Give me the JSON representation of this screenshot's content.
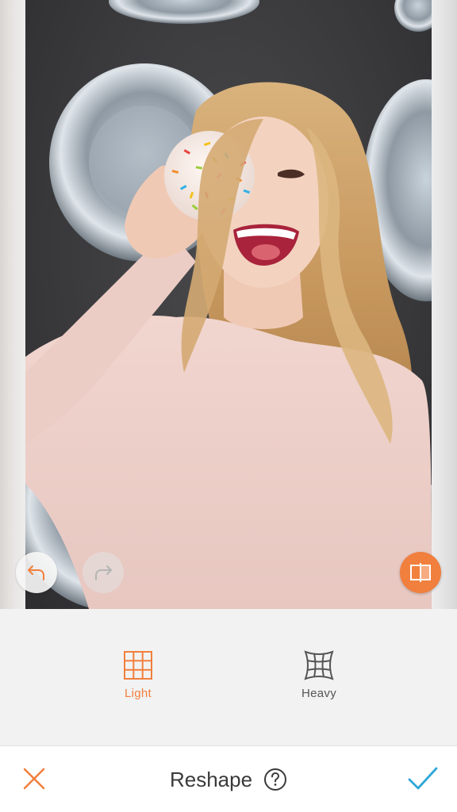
{
  "editor": {
    "tool_title": "Reshape",
    "modes": [
      {
        "label": "Light",
        "icon": "grid-light-icon",
        "selected": true
      },
      {
        "label": "Heavy",
        "icon": "grid-warp-icon",
        "selected": false
      }
    ]
  },
  "controls": {
    "undo_icon": "undo-arrow-icon",
    "redo_icon": "redo-arrow-icon",
    "compare_icon": "split-compare-icon",
    "cancel_icon": "close-x-icon",
    "confirm_icon": "checkmark-icon",
    "help_icon": "question-circle-icon"
  },
  "colors": {
    "accent": "#f17f3d",
    "confirm": "#2ea7d8",
    "background": "#f2f2f2"
  }
}
